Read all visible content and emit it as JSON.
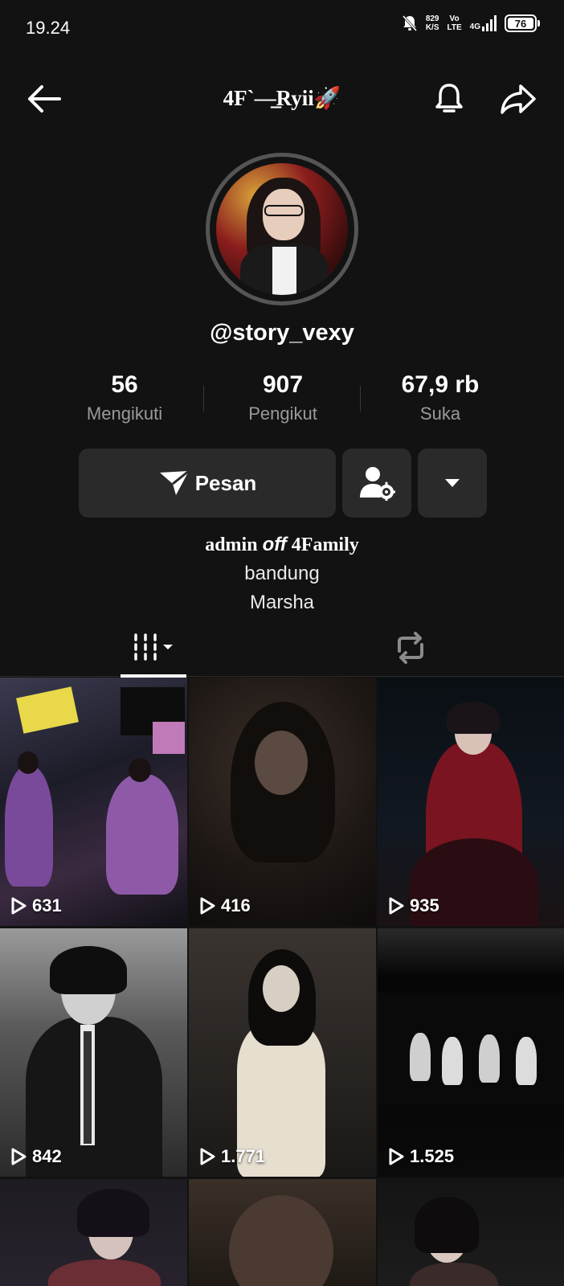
{
  "status_bar": {
    "time": "19.24",
    "net_speed": "829",
    "net_unit": "K/S",
    "volte_top": "Vo",
    "volte_bottom": "LTE",
    "network": "4G",
    "battery": "76"
  },
  "header": {
    "title": "4F`—̲Ryii🚀"
  },
  "profile": {
    "username": "@story_vexy",
    "stats": [
      {
        "value": "56",
        "label": "Mengikuti"
      },
      {
        "value": "907",
        "label": "Pengikut"
      },
      {
        "value": "67,9 rb",
        "label": "Suka"
      }
    ],
    "message_button": "Pesan",
    "bio": {
      "line1_start": "admin ",
      "line1_mid": "off",
      "line1_end": " 4Family",
      "line2": "bandung",
      "line3": "Marsha"
    }
  },
  "videos": [
    {
      "views": "631"
    },
    {
      "views": "416"
    },
    {
      "views": "935"
    },
    {
      "views": "842"
    },
    {
      "views": "1.771"
    },
    {
      "views": "1.525"
    }
  ],
  "icons": [
    "back-arrow-icon",
    "bell-icon",
    "share-icon",
    "send-icon",
    "user-settings-icon",
    "caret-down-icon",
    "grid-icon",
    "repost-icon",
    "play-icon"
  ],
  "colors": {
    "background": "#121212",
    "button": "#2a2a2a",
    "secondary_text": "#9a9a9a"
  }
}
